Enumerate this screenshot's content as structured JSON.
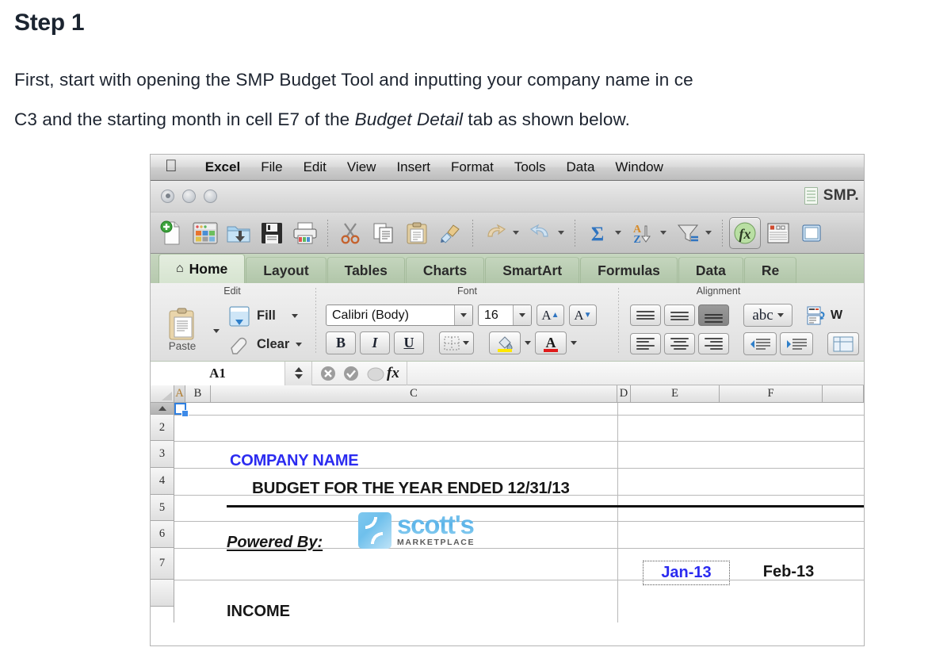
{
  "article": {
    "heading": "Step 1",
    "paragraph_line1": "First, start with opening the SMP Budget Tool and inputting your company name in ce",
    "paragraph_line2_a": "C3 and the starting month in cell E7 of the ",
    "paragraph_line2_italic": "Budget Detail",
    "paragraph_line2_b": " tab as shown below."
  },
  "excel": {
    "menubar": {
      "apple_glyph": "apple-logo",
      "items": [
        "Excel",
        "File",
        "Edit",
        "View",
        "Insert",
        "Format",
        "Tools",
        "Data",
        "Window"
      ]
    },
    "titlebar": {
      "document_name": "SMP.",
      "window_buttons": [
        "close",
        "minimize",
        "zoom"
      ]
    },
    "toolbar": {
      "icons": [
        "new-document-icon",
        "template-gallery-icon",
        "open-folder-icon",
        "save-icon",
        "print-icon",
        "cut-scissors-icon",
        "copy-icon",
        "paste-icon",
        "format-painter-icon",
        "undo-icon",
        "redo-icon",
        "autosum-icon",
        "sort-az-icon",
        "filter-icon",
        "formula-builder-icon",
        "toolbox-icon",
        "zoom-icon"
      ]
    },
    "ribbon_tabs": [
      {
        "label": "Home",
        "active": true,
        "icon": "home-icon"
      },
      {
        "label": "Layout",
        "active": false
      },
      {
        "label": "Tables",
        "active": false
      },
      {
        "label": "Charts",
        "active": false
      },
      {
        "label": "SmartArt",
        "active": false
      },
      {
        "label": "Formulas",
        "active": false
      },
      {
        "label": "Data",
        "active": false
      },
      {
        "label": "Re",
        "active": false
      }
    ],
    "ribbon": {
      "groups": [
        {
          "label": "Edit"
        },
        {
          "label": "Font"
        },
        {
          "label": "Alignment"
        }
      ],
      "edit": {
        "paste_label": "Paste",
        "fill_label": "Fill",
        "clear_label": "Clear"
      },
      "font": {
        "font_name": "Calibri (Body)",
        "font_size": "16",
        "grow_label": "A",
        "shrink_label": "A",
        "bold_label": "B",
        "italic_label": "I",
        "underline_label": "U"
      },
      "alignment": {
        "orientation_label": "abc",
        "wrap_text_label": "W"
      }
    },
    "formula_bar": {
      "name_box": "A1",
      "cancel_icon": "cancel-x-icon",
      "accept_icon": "accept-check-icon",
      "fx_label": "fx"
    },
    "sheet": {
      "columns": [
        "A",
        "B",
        "C",
        "D",
        "E",
        "F"
      ],
      "rows": [
        "2",
        "3",
        "4",
        "5",
        "6",
        "7"
      ],
      "selected_cell": "A1",
      "cells": {
        "c3": "COMPANY NAME",
        "c4": "BUDGET FOR THE YEAR ENDED 12/31/13",
        "b6": "Powered By:",
        "logo_text": "scott's",
        "logo_subtext": "MARKETPLACE",
        "e7": "Jan-13",
        "f7": "Feb-13",
        "b8": "INCOME"
      },
      "colors": {
        "company_name": "#2b2bf0",
        "month_selected": "#2b2bf0",
        "logo_blue": "#6fbeeb"
      }
    }
  }
}
